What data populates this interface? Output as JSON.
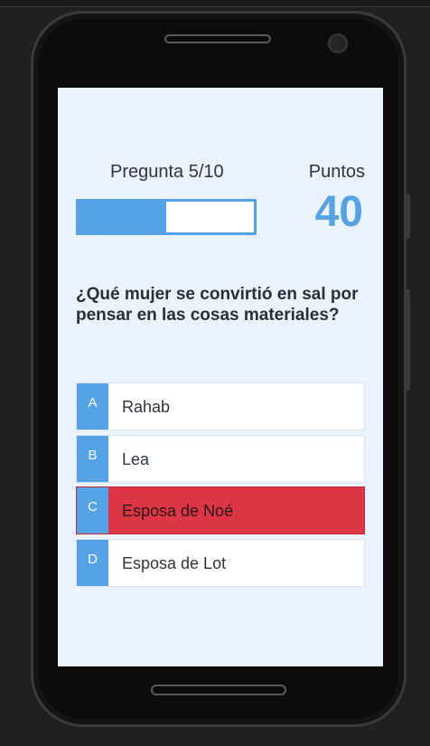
{
  "quiz": {
    "question_counter": "Pregunta 5/10",
    "progress": 0.5,
    "score_label": "Puntos",
    "score_value": "40",
    "question": "¿Qué mujer se convirtió en sal por pensar en las cosas materiales?",
    "answers": [
      {
        "letter": "A",
        "text": "Rahab",
        "state": "default"
      },
      {
        "letter": "B",
        "text": "Lea",
        "state": "default"
      },
      {
        "letter": "C",
        "text": "Esposa de Noé",
        "state": "wrong"
      },
      {
        "letter": "D",
        "text": "Esposa de Lot",
        "state": "default"
      }
    ]
  },
  "colors": {
    "accent": "#55a2e6",
    "wrong": "#dc3545",
    "screen_background": "#ebf3fe"
  }
}
